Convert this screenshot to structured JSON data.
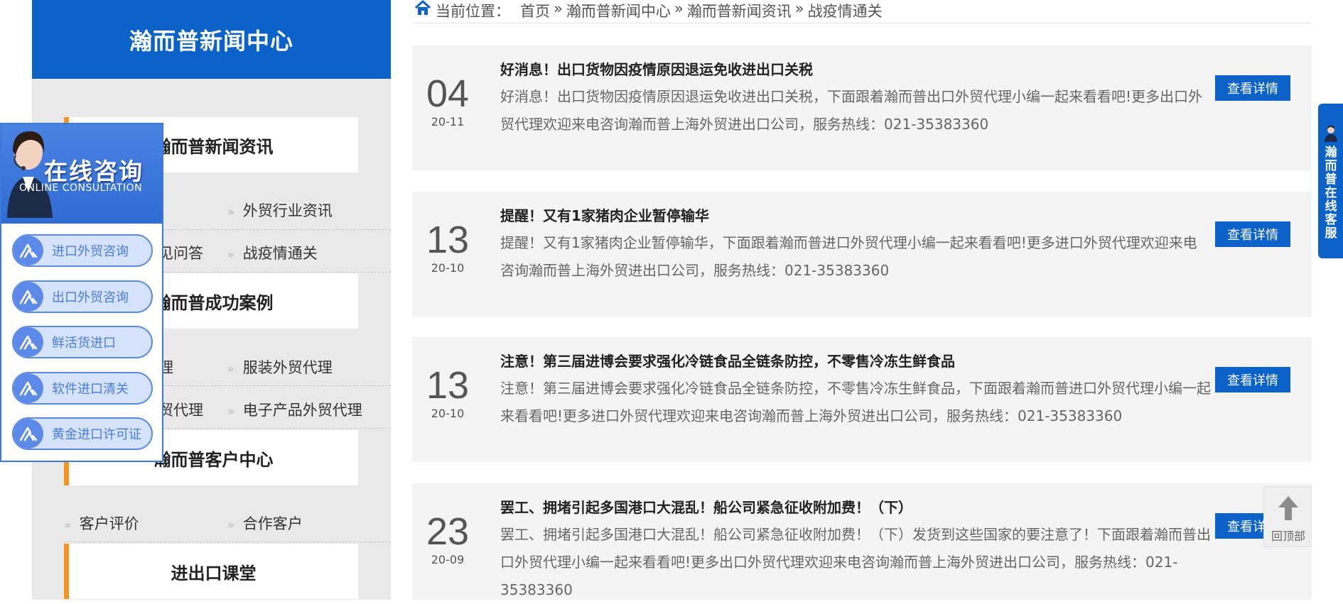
{
  "sidebar": {
    "title": "瀚而普新闻中心",
    "categories": [
      {
        "label": "瀚而普新闻资讯"
      },
      {
        "label": "瀚而普成功案例"
      },
      {
        "label": "瀚而普客户中心"
      },
      {
        "label": "进出口课堂"
      }
    ],
    "sub_items": [
      {
        "label": "外贸行业资讯"
      },
      {
        "label": "见问答"
      },
      {
        "label": "战疫情通关"
      },
      {
        "label": "理"
      },
      {
        "label": "服装外贸代理"
      },
      {
        "label": "贸代理"
      },
      {
        "label": "电子产品外贸代理"
      },
      {
        "label": "客户评价"
      },
      {
        "label": "合作客户"
      }
    ]
  },
  "consult": {
    "title": "在线咨询",
    "subtitle": "ONLINE CONSULTATION",
    "items": [
      {
        "label": "进口外贸咨询"
      },
      {
        "label": "出口外贸咨询"
      },
      {
        "label": "鲜活货进口"
      },
      {
        "label": "软件进口清关"
      },
      {
        "label": "黄金进口许可证"
      }
    ]
  },
  "breadcrumb": {
    "prefix": "当前位置：",
    "items": [
      "首页",
      "瀚而普新闻中心",
      "瀚而普新闻资讯",
      "战疫情通关"
    ],
    "separator": "»"
  },
  "news": [
    {
      "day": "04",
      "ym": "20-11",
      "title": "好消息！出口货物因疫情原因退运免收进出口关税",
      "desc": "好消息！出口货物因疫情原因退运免收进出口关税，下面跟着瀚而普出口外贸代理小编一起来看看吧!更多出口外贸代理欢迎来电咨询瀚而普上海外贸进出口公司，服务热线：021-35383360",
      "button": "查看详情"
    },
    {
      "day": "13",
      "ym": "20-10",
      "title": "提醒！又有1家猪肉企业暂停输华",
      "desc": "提醒！又有1家猪肉企业暂停输华，下面跟着瀚而普进口外贸代理小编一起来看看吧!更多进口外贸代理欢迎来电咨询瀚而普上海外贸进出口公司，服务热线：021-35383360",
      "button": "查看详情"
    },
    {
      "day": "13",
      "ym": "20-10",
      "title": "注意！第三届进博会要求强化冷链食品全链条防控，不零售冷冻生鲜食品",
      "desc": "注意！第三届进博会要求强化冷链食品全链条防控，不零售冷冻生鲜食品，下面跟着瀚而普进口外贸代理小编一起来看看吧!更多进口外贸代理欢迎来电咨询瀚而普上海外贸进出口公司，服务热线：021-35383360",
      "button": "查看详情"
    },
    {
      "day": "23",
      "ym": "20-09",
      "title": "罢工、拥堵引起多国港口大混乱！船公司紧急征收附加费！（下）",
      "desc": "罢工、拥堵引起多国港口大混乱！船公司紧急征收附加费！（下）发货到这些国家的要注意了！下面跟着瀚而普出口外贸代理小编一起来看看吧!更多出口外贸代理欢迎来电咨询瀚而普上海外贸进出口公司，服务热线：021-35383360",
      "button": "查看详情"
    }
  ],
  "online_service": {
    "label": "瀚而普在线客服"
  },
  "back_to_top": {
    "label": "回顶部"
  },
  "colors": {
    "brand_blue": "#0b62c9",
    "accent_orange": "#f7961f"
  }
}
